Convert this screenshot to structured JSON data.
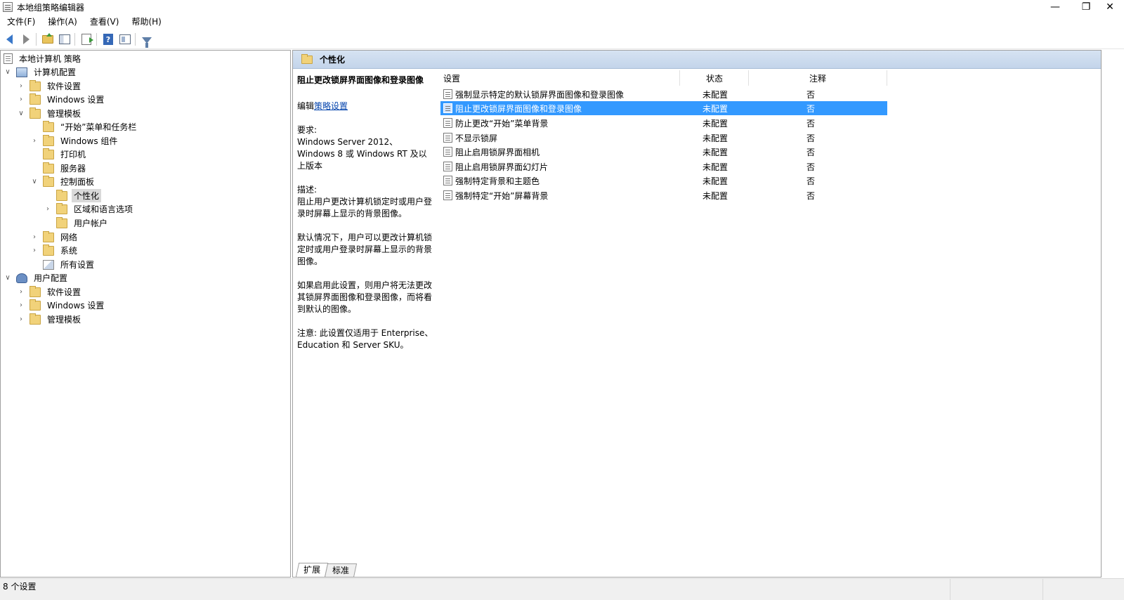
{
  "window": {
    "title": "本地组策略编辑器",
    "minimize_glyph": "—",
    "maximize_glyph": "❐",
    "close_glyph": "✕"
  },
  "menu": [
    "文件(F)",
    "操作(A)",
    "查看(V)",
    "帮助(H)"
  ],
  "toolbar": {
    "icons": [
      "back-arrow-icon",
      "forward-arrow-icon",
      "up-folder-icon",
      "show-hide-tree-icon",
      "export-list-icon",
      "help-icon",
      "properties-icon",
      "filter-icon"
    ],
    "help_glyph": "?"
  },
  "tree": {
    "items": [
      {
        "label": "本地计算机 策略",
        "icon": "document-icon",
        "expander": ""
      },
      {
        "label": "计算机配置",
        "icon": "computer-icon",
        "expander": "∨"
      },
      {
        "label": "软件设置",
        "icon": "folder-icon",
        "expander": "›"
      },
      {
        "label": "Windows 设置",
        "icon": "folder-icon",
        "expander": "›"
      },
      {
        "label": "管理模板",
        "icon": "folder-icon",
        "expander": "∨"
      },
      {
        "label": "“开始”菜单和任务栏",
        "icon": "folder-icon",
        "expander": ""
      },
      {
        "label": "Windows 组件",
        "icon": "folder-icon",
        "expander": "›"
      },
      {
        "label": "打印机",
        "icon": "folder-icon",
        "expander": ""
      },
      {
        "label": "服务器",
        "icon": "folder-icon",
        "expander": ""
      },
      {
        "label": "控制面板",
        "icon": "folder-icon",
        "expander": "∨"
      },
      {
        "label": "个性化",
        "icon": "folder-icon",
        "expander": "",
        "selected": true
      },
      {
        "label": "区域和语言选项",
        "icon": "folder-icon",
        "expander": "›"
      },
      {
        "label": "用户帐户",
        "icon": "folder-icon",
        "expander": ""
      },
      {
        "label": "网络",
        "icon": "folder-icon",
        "expander": "›"
      },
      {
        "label": "系统",
        "icon": "folder-icon",
        "expander": "›"
      },
      {
        "label": "所有设置",
        "icon": "all-settings-icon",
        "expander": ""
      },
      {
        "label": "用户配置",
        "icon": "user-icon",
        "expander": "∨"
      },
      {
        "label": "软件设置",
        "icon": "folder-icon",
        "expander": "›"
      },
      {
        "label": "Windows 设置",
        "icon": "folder-icon",
        "expander": "›"
      },
      {
        "label": "管理模板",
        "icon": "folder-icon",
        "expander": "›"
      }
    ]
  },
  "right": {
    "header_title": "个性化",
    "description": {
      "title": "阻止更改锁屏界面图像和登录图像",
      "edit_prefix": "编辑",
      "edit_link": "策略设置",
      "requirements_label": "要求:",
      "requirements_text": "Windows Server 2012、Windows 8 或 Windows RT 及以上版本",
      "desc_label": "描述:",
      "desc_text": "阻止用户更改计算机锁定时或用户登录时屏幕上显示的背景图像。",
      "default_text": "默认情况下，用户可以更改计算机锁定时或用户登录时屏幕上显示的背景图像。",
      "enabled_text": "如果启用此设置，则用户将无法更改其锁屏界面图像和登录图像，而将看到默认的图像。",
      "note_text": "注意: 此设置仅适用于 Enterprise、Education 和 Server SKU。"
    },
    "columns": [
      "设置",
      "状态",
      "注释"
    ],
    "rows": [
      {
        "name": "强制显示特定的默认锁屏界面图像和登录图像",
        "state": "未配置",
        "note": "否"
      },
      {
        "name": "阻止更改锁屏界面图像和登录图像",
        "state": "未配置",
        "note": "否",
        "selected": true
      },
      {
        "name": "防止更改“开始”菜单背景",
        "state": "未配置",
        "note": "否"
      },
      {
        "name": "不显示锁屏",
        "state": "未配置",
        "note": "否"
      },
      {
        "name": "阻止启用锁屏界面相机",
        "state": "未配置",
        "note": "否"
      },
      {
        "name": "阻止启用锁屏界面幻灯片",
        "state": "未配置",
        "note": "否"
      },
      {
        "name": "强制特定背景和主题色",
        "state": "未配置",
        "note": "否"
      },
      {
        "name": "强制特定“开始”屏幕背景",
        "state": "未配置",
        "note": "否"
      }
    ],
    "tabs": [
      "扩展",
      "标准"
    ]
  },
  "status": {
    "text": "8 个设置"
  },
  "colors": {
    "selection": "#3399ff",
    "header_bg": "#c3d4ea",
    "link": "#0645ad"
  }
}
